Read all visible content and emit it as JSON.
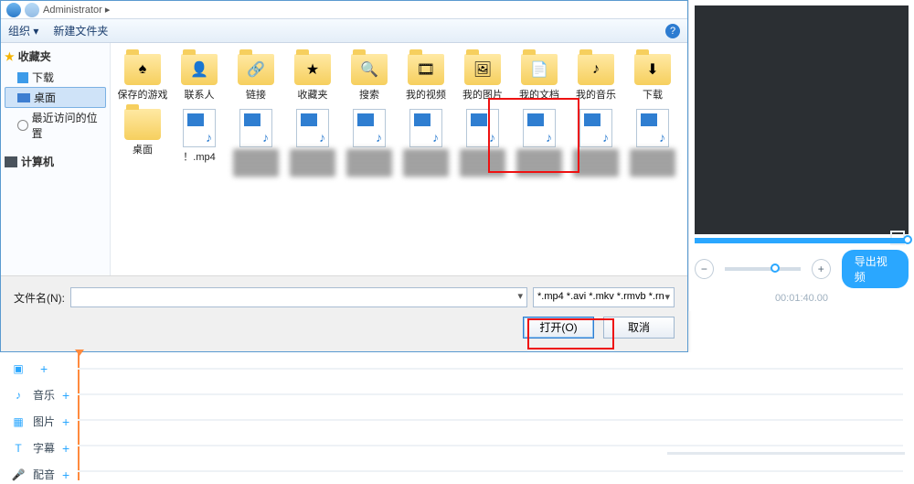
{
  "dialog": {
    "address_bar": "Administrator ▸",
    "toolbar": {
      "organize": "组织 ▾",
      "new_folder": "新建文件夹"
    },
    "sidebar": {
      "favorites_head": "收藏夹",
      "items": [
        {
          "label": "下载"
        },
        {
          "label": "桌面"
        },
        {
          "label": "最近访问的位置"
        }
      ],
      "computer_head": "计算机"
    },
    "folders": [
      {
        "label": "保存的游戏",
        "overlay": "♠"
      },
      {
        "label": "联系人",
        "overlay": "👤"
      },
      {
        "label": "链接",
        "overlay": "🔗"
      },
      {
        "label": "收藏夹",
        "overlay": "★"
      },
      {
        "label": "搜索",
        "overlay": "🔍"
      },
      {
        "label": "我的视频",
        "overlay": "🎞"
      },
      {
        "label": "我的图片",
        "overlay": "🖼"
      },
      {
        "label": "我的文档",
        "overlay": "📄"
      },
      {
        "label": "我的音乐",
        "overlay": "♪"
      },
      {
        "label": "下载",
        "overlay": "⬇"
      }
    ],
    "files_row2": [
      {
        "label": "桌面",
        "kind": "folder"
      },
      {
        "label": "！.mp4",
        "kind": "video"
      }
    ],
    "file_name_label": "文件名(N):",
    "file_name_value": "",
    "file_type": "*.mp4 *.avi *.mkv *.rmvb *.rn",
    "open_btn": "打开(O)",
    "cancel_btn": "取消"
  },
  "video": {
    "export_label": "导出视频",
    "timecode": "00:01:40.00"
  },
  "tracks": [
    {
      "icon": "▣",
      "label": ""
    },
    {
      "icon": "♪",
      "label": "音乐"
    },
    {
      "icon": "▦",
      "label": "图片"
    },
    {
      "icon": "T",
      "label": "字幕"
    },
    {
      "icon": "🎤",
      "label": "配音"
    }
  ]
}
